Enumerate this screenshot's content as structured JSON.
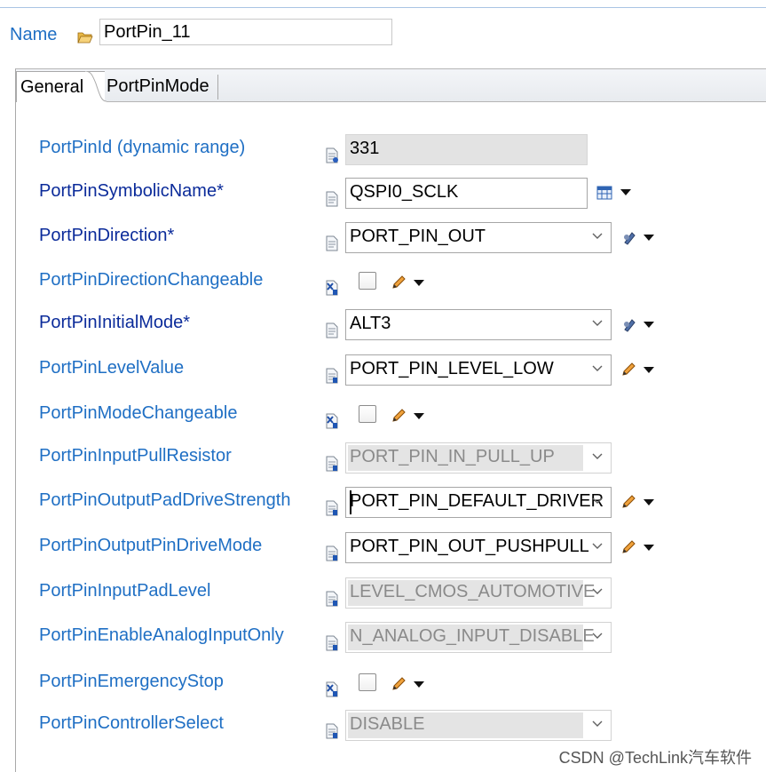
{
  "header": {
    "name_label": "Name",
    "name_value": "PortPin_11"
  },
  "tabs": [
    {
      "label": "General",
      "active": true
    },
    {
      "label": "PortPinMode",
      "active": false
    }
  ],
  "fields": [
    {
      "label": "PortPinId (dynamic range)",
      "required": false,
      "kind": "readonly-text",
      "value": "331"
    },
    {
      "label": "PortPinSymbolicName*",
      "required": true,
      "kind": "text",
      "value": "QSPI0_SCLK"
    },
    {
      "label": "PortPinDirection*",
      "required": true,
      "kind": "select",
      "value": "PORT_PIN_OUT"
    },
    {
      "label": "PortPinDirectionChangeable",
      "required": false,
      "kind": "checkbox",
      "checked": false
    },
    {
      "label": "PortPinInitialMode*",
      "required": true,
      "kind": "select",
      "value": "ALT3"
    },
    {
      "label": "PortPinLevelValue",
      "required": false,
      "kind": "select",
      "value": "PORT_PIN_LEVEL_LOW"
    },
    {
      "label": "PortPinModeChangeable",
      "required": false,
      "kind": "checkbox",
      "checked": false
    },
    {
      "label": "PortPinInputPullResistor",
      "required": false,
      "kind": "disabled-select",
      "value": "PORT_PIN_IN_PULL_UP"
    },
    {
      "label": "PortPinOutputPadDriveStrength",
      "required": false,
      "kind": "select",
      "value": "PORT_PIN_DEFAULT_DRIVER",
      "focused": true
    },
    {
      "label": "PortPinOutputPinDriveMode",
      "required": false,
      "kind": "select",
      "value": "PORT_PIN_OUT_PUSHPULL"
    },
    {
      "label": "PortPinInputPadLevel",
      "required": false,
      "kind": "disabled-select",
      "value": "LEVEL_CMOS_AUTOMOTIVE"
    },
    {
      "label": "PortPinEnableAnalogInputOnly",
      "required": false,
      "kind": "disabled-select",
      "value": "N_ANALOG_INPUT_DISABLE"
    },
    {
      "label": "PortPinEmergencyStop",
      "required": false,
      "kind": "checkbox",
      "checked": false
    },
    {
      "label": "PortPinControllerSelect",
      "required": false,
      "kind": "disabled-select",
      "value": "DISABLE"
    }
  ],
  "watermark": "CSDN @TechLink汽车软件",
  "colors": {
    "optional_label": "#1f6fc4",
    "required_label": "#0b2b9a",
    "readonly_bg": "#e3e3e3"
  }
}
